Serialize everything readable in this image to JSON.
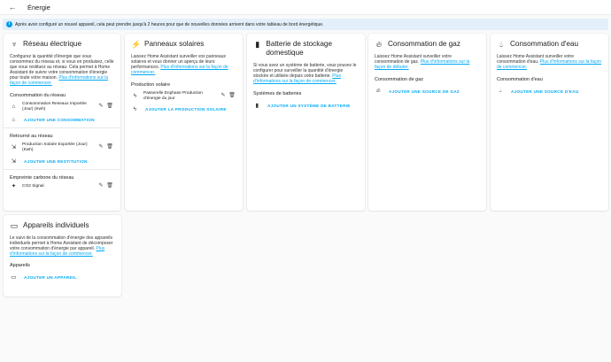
{
  "header": {
    "title": "Énergie"
  },
  "banner": {
    "text": "Après avoir configuré un nouvel appareil, cela peut prendre jusqu'à 2 heures pour que de nouvelles données arrivent dans votre tableau de bord énergétique."
  },
  "grid_card": {
    "title": "Réseau électrique",
    "desc": "Configurez la quantité d'énergie que vous consommez du réseau et, si vous en produisez, celle que vous restituez au réseau. Cela permet à Home Assistant de suivre votre consommation d'énergie pour toute votre maison.",
    "link": "Plus d'informations sur la façon de commencer.",
    "consumption_heading": "Consommation du réseau",
    "consumption_item": "Consommation Reseaux Importée (Jour) (Kwh)",
    "add_consumption": "AJOUTER UNE CONSOMMATION",
    "return_heading": "Retourné au réseau",
    "return_item": "Production Solaire Exportée (Jour) (Kwh)",
    "add_return": "AJOUTER UNE RESTITUTION",
    "co2_heading": "Empreinte carbone du réseau",
    "co2_item": "CO2 Signal"
  },
  "solar_card": {
    "title": "Panneaux solaires",
    "desc": "Laissez Home Assistant surveiller vos panneaux solaires et vous donner un aperçu de leurs performances.",
    "link": "Plus d'informations sur la façon de commencer.",
    "heading": "Production solaire",
    "item": "Passerelle Enphase Production d'énergie du jour",
    "add": "AJOUTER LA PRODUCTION SOLAIRE"
  },
  "battery_card": {
    "title": "Batterie de stockage domestique",
    "desc": "Si vous avez un système de batterie, vous pouvez le configurer pour surveiller la quantité d'énergie stockée et utilisée depuis votre batterie.",
    "link": "Plus d'informations sur la façon de commencer.",
    "heading": "Systèmes de batteries",
    "add": "AJOUTER UN SYSTÈME DE BATTERIE"
  },
  "gas_card": {
    "title": "Consommation de gaz",
    "desc": "Laissez Home Assistant surveiller votre consommation de gaz.",
    "link": "Plus d'informations sur la façon de débuter.",
    "heading": "Consommation de gaz",
    "add": "AJOUTER UNE SOURCE DE GAZ"
  },
  "water_card": {
    "title": "Consommation d'eau",
    "desc": "Laissez Home Assistant surveiller votre consommation d'eau.",
    "link": "Plus d'informations sur la façon de commencer.",
    "heading": "Consommation d'eau",
    "add": "AJOUTER UNE SOURCE D'EAU"
  },
  "devices_card": {
    "title": "Appareils individuels",
    "desc": "Le suivi de la consommation d'énergie des appareils individuels permet à Home Assistant de décomposer votre consommation d'énergie par appareil.",
    "link": "Plus d'informations sur la façon de commencer.",
    "heading": "Appareils",
    "add": "AJOUTER UN APPAREIL"
  },
  "icons": {
    "back": "arrow-left-icon",
    "info": "info-icon",
    "grid": "transmission-tower-icon",
    "solar": "solar-power-icon",
    "battery": "battery-icon",
    "gas": "fire-icon",
    "water": "water-icon",
    "devices": "devices-icon",
    "edit": "pencil-icon",
    "delete": "trash-icon"
  }
}
